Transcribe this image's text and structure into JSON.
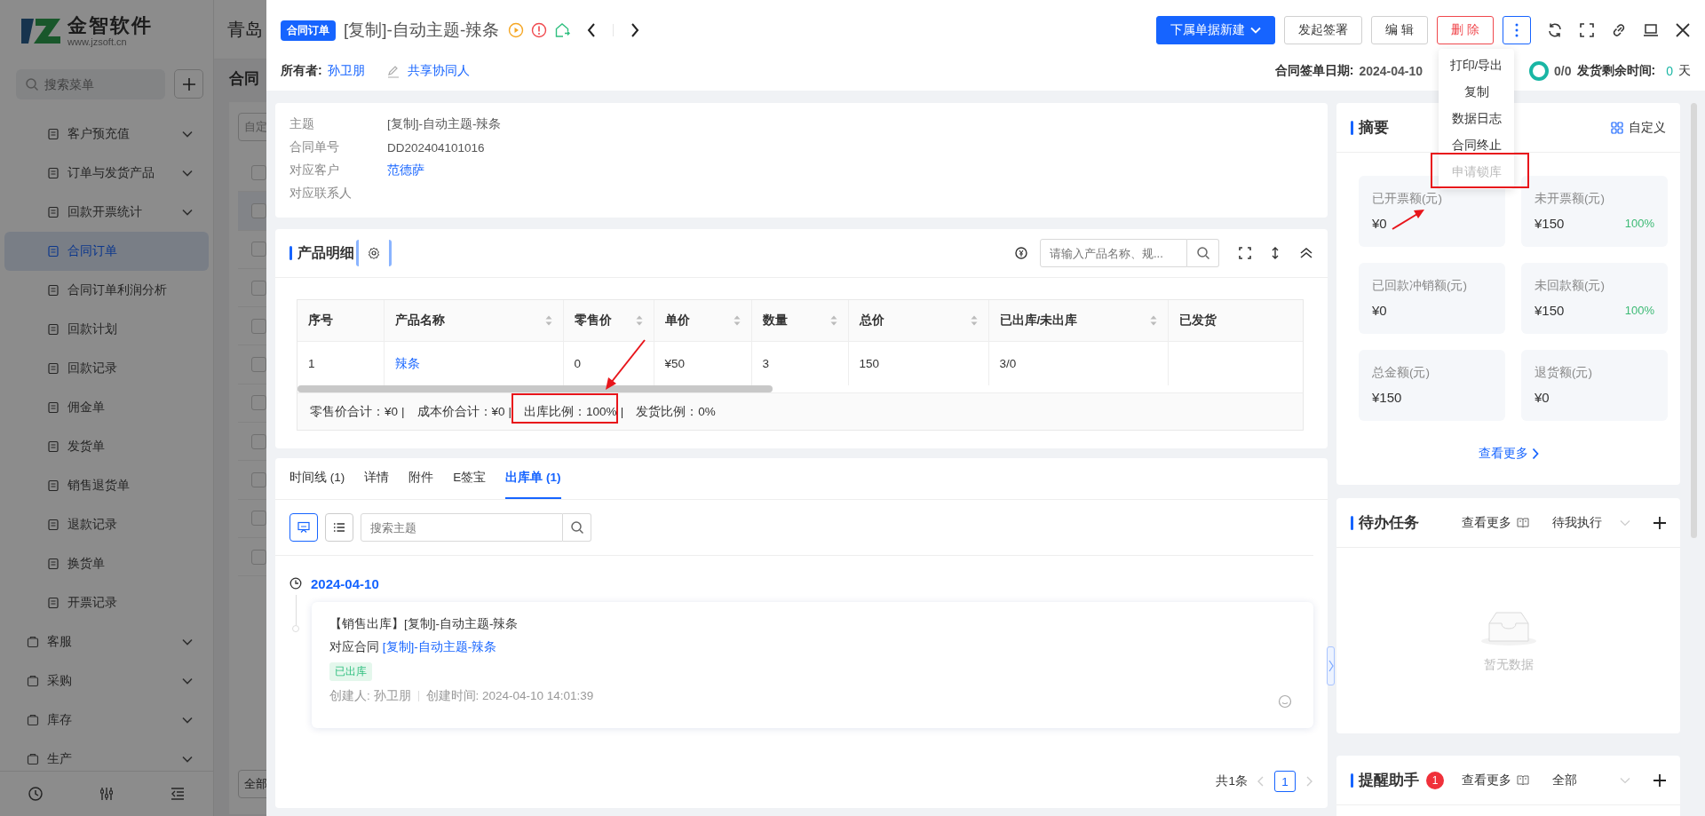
{
  "background_page": {
    "logo": {
      "name": "金智软件",
      "url": "www.jzsoft.cn"
    },
    "company": "青岛",
    "menu_search": {
      "placeholder": "搜索菜单"
    },
    "submenu_items": [
      {
        "label": "客户预充值",
        "expandable": true,
        "selected": false
      },
      {
        "label": "订单与发货产品",
        "expandable": true,
        "selected": false
      },
      {
        "label": "回款开票统计",
        "expandable": true,
        "selected": false
      },
      {
        "label": "合同订单",
        "expandable": false,
        "selected": true
      },
      {
        "label": "合同订单利润分析",
        "expandable": false,
        "selected": false
      },
      {
        "label": "回款计划",
        "expandable": false,
        "selected": false
      },
      {
        "label": "回款记录",
        "expandable": false,
        "selected": false
      },
      {
        "label": "佣金单",
        "expandable": false,
        "selected": false
      },
      {
        "label": "发货单",
        "expandable": false,
        "selected": false
      },
      {
        "label": "销售退货单",
        "expandable": false,
        "selected": false
      },
      {
        "label": "退款记录",
        "expandable": false,
        "selected": false
      },
      {
        "label": "换货单",
        "expandable": false,
        "selected": false
      },
      {
        "label": "开票记录",
        "expandable": false,
        "selected": false
      }
    ],
    "menu_items": [
      {
        "label": "客服"
      },
      {
        "label": "采购"
      },
      {
        "label": "库存"
      },
      {
        "label": "生产"
      }
    ],
    "page_title": "合同",
    "filter_button": "自定",
    "footer_button": "全部",
    "rows": [
      {
        "checked": false
      },
      {
        "checked": false
      },
      {
        "checked": false
      },
      {
        "checked": false
      },
      {
        "checked": false
      },
      {
        "checked": false
      },
      {
        "checked": false
      },
      {
        "checked": false
      },
      {
        "checked": false
      },
      {
        "checked": false
      },
      {
        "checked": false
      }
    ]
  },
  "drawer": {
    "badge": "合同订单",
    "title": "[复制]-自动主题-辣条",
    "actions": [
      {
        "label": "下属单据新建",
        "kind": "primary",
        "dropdown": true
      },
      {
        "label": "发起签署",
        "kind": "default",
        "dropdown": false
      },
      {
        "label": "编 辑",
        "kind": "default",
        "dropdown": false
      },
      {
        "label": "删 除",
        "kind": "danger",
        "dropdown": false
      }
    ],
    "owner_label": "所有者:",
    "owner": "孙卫朋",
    "share": "共享协同人",
    "sign_date_label": "合同签单日期:",
    "sign_date": "2024-04-10",
    "progress": "0/0",
    "remaining_label": "发货剩余时间:",
    "remaining_value": "0",
    "remaining_unit": "天",
    "more_menu": [
      {
        "label": "打印/导出",
        "disabled": false
      },
      {
        "label": "复制",
        "disabled": false
      },
      {
        "label": "数据日志",
        "disabled": false
      },
      {
        "label": "合同终止",
        "disabled": false
      },
      {
        "label": "申请锁库",
        "disabled": true
      }
    ]
  },
  "info": [
    {
      "label": "主题",
      "value": "[复制]-自动主题-辣条",
      "kind": "text"
    },
    {
      "label": "合同单号",
      "value": "DD202404101016",
      "kind": "text"
    },
    {
      "label": "对应客户",
      "value": "范德萨",
      "kind": "link"
    },
    {
      "label": "对应联系人"
    }
  ],
  "products": {
    "title": "产品明细",
    "search": {
      "placeholder": "请输入产品名称、规..."
    },
    "columns": [
      {
        "label": "序号",
        "sortable": false
      },
      {
        "label": "产品名称",
        "sortable": true
      },
      {
        "label": "零售价",
        "sortable": true
      },
      {
        "label": "单价",
        "sortable": true
      },
      {
        "label": "数量",
        "sortable": true
      },
      {
        "label": "总价",
        "sortable": true
      },
      {
        "label": "已出库/未出库",
        "sortable": true
      },
      {
        "label": "已发货",
        "sortable": false
      }
    ],
    "rows": [
      {
        "cells": [
          "1",
          "辣条",
          "0",
          "¥50",
          "3",
          "150",
          "3/0"
        ]
      }
    ],
    "totals": [
      {
        "text": "零售价合计：¥0",
        "separator": "|"
      },
      {
        "text": "成本价合计：¥0",
        "separator": "|"
      },
      {
        "text": "出库比例：100%",
        "separator": "|"
      },
      {
        "text": "发货比例：0%"
      }
    ]
  },
  "tabs": [
    {
      "label": "时间线 (1)",
      "selected": false
    },
    {
      "label": "详情",
      "selected": false
    },
    {
      "label": "附件",
      "selected": false
    },
    {
      "label": "E签宝",
      "selected": false
    },
    {
      "label": "出库单 (1)",
      "selected": true
    }
  ],
  "view_buttons": [
    {
      "kind": "board",
      "selected": true
    },
    {
      "kind": "list",
      "selected": false
    }
  ],
  "timeline_search": {
    "placeholder": "搜索主题"
  },
  "timeline": [
    {
      "date": "2024-04-10",
      "entries": [
        {
          "title": "【销售出库】[复制]-自动主题-辣条",
          "contract_label": "对应合同",
          "contract": "[复制]-自动主题-辣条",
          "status": "已出库",
          "creator": "创建人: 孙卫朋",
          "created": "创建时间: 2024-04-10 14:01:39"
        }
      ]
    }
  ],
  "pagination": {
    "total": "共1条",
    "pages": [
      {
        "label": "1",
        "selected": true
      }
    ]
  },
  "summary": {
    "title": "摘要",
    "customize": "自定义",
    "stats": [
      {
        "label": "已开票额(元)",
        "value": "¥0"
      },
      {
        "label": "未开票额(元)",
        "value": "¥150",
        "percent": "100%"
      },
      {
        "label": "已回款冲销额(元)",
        "value": "¥0"
      },
      {
        "label": "未回款额(元)",
        "value": "¥150",
        "percent": "100%"
      },
      {
        "label": "总金额(元)",
        "value": "¥150"
      },
      {
        "label": "退货额(元)",
        "value": "¥0"
      }
    ],
    "more": "查看更多"
  },
  "tasks": {
    "title": "待办任务",
    "more": "查看更多",
    "filter": "待我执行",
    "empty": "暂无数据"
  },
  "reminders": {
    "title": "提醒助手",
    "count": "1",
    "more": "查看更多",
    "filter": "全部"
  }
}
